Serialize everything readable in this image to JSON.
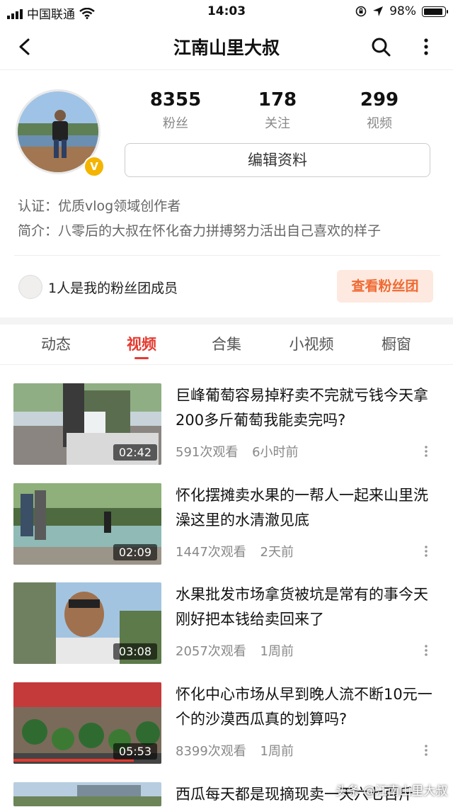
{
  "status_bar": {
    "carrier": "中国联通",
    "time": "14:03",
    "battery": "98%",
    "battery_level": 0.98
  },
  "nav": {
    "title": "江南山里大叔"
  },
  "profile": {
    "stats": [
      {
        "value": "8355",
        "label": "粉丝"
      },
      {
        "value": "178",
        "label": "关注"
      },
      {
        "value": "299",
        "label": "视频"
      }
    ],
    "edit_label": "编辑资料",
    "verified_badge": "V",
    "certification": "认证：优质vlog领域创作者",
    "bio": "简介：八零后的大叔在怀化奋力拼搏努力活出自己喜欢的样子"
  },
  "fans_club": {
    "text": "1人是我的粉丝团成员",
    "button": "查看粉丝团"
  },
  "tabs": [
    {
      "label": "动态"
    },
    {
      "label": "视频"
    },
    {
      "label": "合集"
    },
    {
      "label": "小视频"
    },
    {
      "label": "橱窗"
    }
  ],
  "videos": [
    {
      "title": "巨峰葡萄容易掉籽卖不完就亏钱今天拿200多斤葡萄我能卖完吗?",
      "duration": "02:42",
      "views": "591次观看",
      "time": "6小时前"
    },
    {
      "title": "怀化摆摊卖水果的一帮人一起来山里洗澡这里的水清澈见底",
      "duration": "02:09",
      "views": "1447次观看",
      "time": "2天前"
    },
    {
      "title": "水果批发市场拿货被坑是常有的事今天刚好把本钱给卖回来了",
      "duration": "03:08",
      "views": "2057次观看",
      "time": "1周前"
    },
    {
      "title": "怀化中心市场从早到晚人流不断10元一个的沙漠西瓜真的划算吗?",
      "duration": "05:53",
      "views": "8399次观看",
      "time": "1周前"
    },
    {
      "title": "西瓜每天都是现摘现卖一天六七百斤"
    }
  ],
  "watermark": "头条 @江南山里大叔",
  "colors": {
    "accent": "#e53a30",
    "fans_button_bg": "#fde9df",
    "fans_button_text": "#ef6a33",
    "badge": "#f4b400"
  }
}
